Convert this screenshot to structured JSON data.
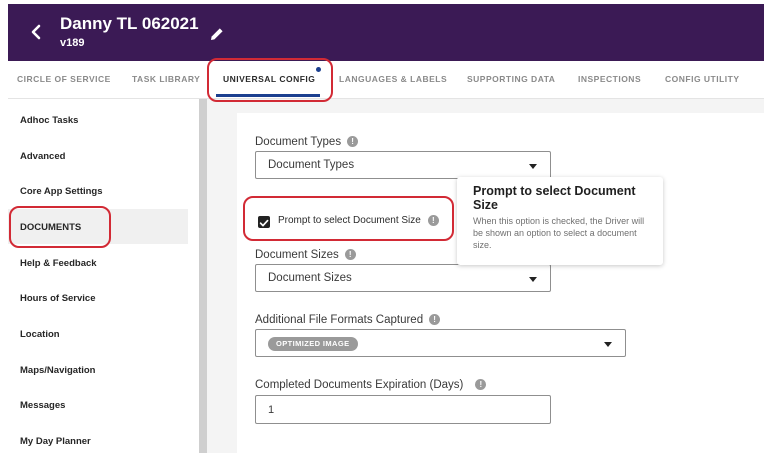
{
  "header": {
    "title": "Danny TL 062021",
    "version": "v189"
  },
  "tabs": [
    {
      "label": "CIRCLE OF SERVICE"
    },
    {
      "label": "TASK LIBRARY"
    },
    {
      "label": "UNIVERSAL CONFIG"
    },
    {
      "label": "LANGUAGES & LABELS"
    },
    {
      "label": "SUPPORTING DATA"
    },
    {
      "label": "INSPECTIONS"
    },
    {
      "label": "CONFIG UTILITY"
    }
  ],
  "sidebar": {
    "items": [
      {
        "label": "Adhoc Tasks"
      },
      {
        "label": "Advanced"
      },
      {
        "label": "Core App Settings"
      },
      {
        "label": "DOCUMENTS"
      },
      {
        "label": "Help & Feedback"
      },
      {
        "label": "Hours of Service"
      },
      {
        "label": "Location"
      },
      {
        "label": "Maps/Navigation"
      },
      {
        "label": "Messages"
      },
      {
        "label": "My Day Planner"
      }
    ]
  },
  "form": {
    "document_types": {
      "label": "Document Types",
      "value": "Document Types"
    },
    "prompt_checkbox": {
      "label": "Prompt to select Document Size",
      "checked": true
    },
    "document_sizes": {
      "label": "Document Sizes",
      "value": "Document Sizes"
    },
    "file_formats": {
      "label": "Additional File Formats Captured",
      "chip": "OPTIMIZED IMAGE"
    },
    "expiration": {
      "label": "Completed Documents Expiration (Days)",
      "value": "1"
    },
    "info_glyph": "!"
  },
  "tooltip": {
    "title": "Prompt to select Document Size",
    "body": "When this option is checked, the Driver will be shown an option to select a document size."
  },
  "colors": {
    "header_bg": "#3b1a55",
    "accent": "#1b3f8f",
    "highlight": "#d22a35"
  }
}
